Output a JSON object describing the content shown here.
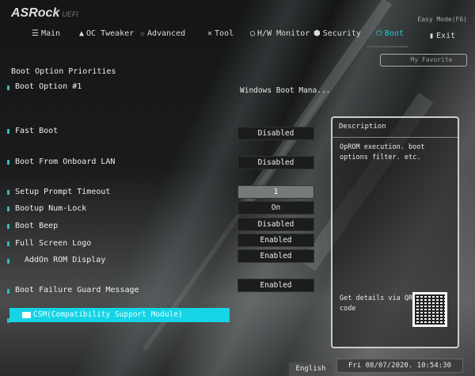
{
  "header": {
    "brand": "ASRock",
    "brand_suffix": "UEFI",
    "easy_mode": "Easy Mode(F6)",
    "my_favorite": "My Favorite"
  },
  "tabs": [
    {
      "label": "Main",
      "icon": "list-icon"
    },
    {
      "label": "OC Tweaker",
      "icon": "rocket-icon"
    },
    {
      "label": "Advanced",
      "icon": "star-icon"
    },
    {
      "label": "Tool",
      "icon": "tools-icon"
    },
    {
      "label": "H/W Monitor",
      "icon": "monitor-icon"
    },
    {
      "label": "Security",
      "icon": "shield-icon"
    },
    {
      "label": "Boot",
      "icon": "power-icon",
      "active": true
    },
    {
      "label": "Exit",
      "icon": "exit-door-icon"
    }
  ],
  "section_title": "Boot Option Priorities",
  "settings": [
    {
      "label": "Boot Option #1",
      "value": "Windows Boot Mana..."
    },
    {
      "label": "Fast Boot",
      "value": "Disabled"
    },
    {
      "label": "Boot From Onboard LAN",
      "value": "Disabled"
    },
    {
      "label": "Setup Prompt Timeout",
      "value": "1"
    },
    {
      "label": "Bootup Num-Lock",
      "value": "On"
    },
    {
      "label": "Boot Beep",
      "value": "Disabled"
    },
    {
      "label": "Full Screen Logo",
      "value": "Enabled"
    },
    {
      "label": "AddOn ROM Display",
      "value": "Enabled"
    },
    {
      "label": "Boot Failure Guard Message",
      "value": "Enabled"
    }
  ],
  "csm": {
    "label": "CSM(Compatibility Support Module)"
  },
  "description": {
    "title": "Description",
    "text": "OpROM execution. boot options filter. etc.",
    "qr_text": "Get details via QR code"
  },
  "footer": {
    "language": "English",
    "datetime": "Fri 08/07/2020. 10:54:30"
  },
  "colors": {
    "accent": "#16d4e6"
  }
}
